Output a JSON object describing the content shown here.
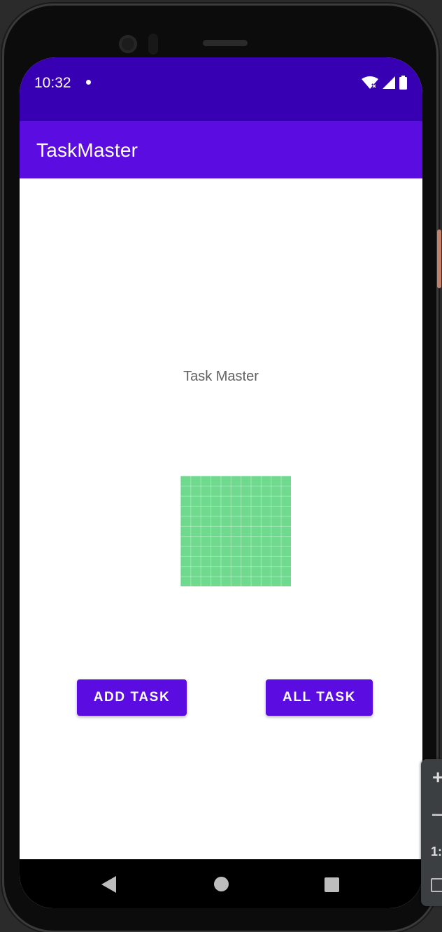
{
  "status_bar": {
    "time": "10:32",
    "icons": [
      "notification-dot-icon",
      "wifi-icon",
      "cell-signal-icon",
      "battery-icon"
    ]
  },
  "app_bar": {
    "title": "TaskMaster"
  },
  "main": {
    "heading": "Task Master",
    "image": "green-grid-pattern",
    "add_task_label": "ADD TASK",
    "all_task_label": "ALL TASK"
  },
  "nav_bar": {
    "icons": [
      "back-icon",
      "home-icon",
      "recents-icon"
    ]
  },
  "emulator_panel": {
    "ratio_label": "1:"
  },
  "colors": {
    "status_bar": "#3700b3",
    "primary": "#5a0ce1",
    "image_fill": "#6fda8e",
    "heading_text": "#616161"
  }
}
